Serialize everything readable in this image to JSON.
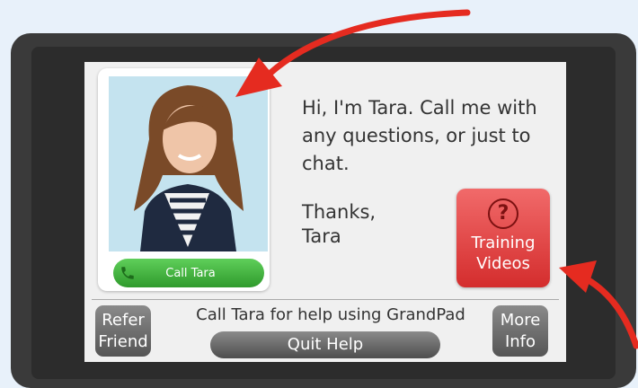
{
  "contact": {
    "name": "Tara",
    "call_label": "Call Tara"
  },
  "message": {
    "line1": "Hi, I'm Tara. Call me with any questions, or just to chat.",
    "thanks": "Thanks,",
    "signature": "Tara"
  },
  "training": {
    "label_line1": "Training",
    "label_line2": "Videos",
    "icon": "question-circle-icon"
  },
  "footer": {
    "refer_line1": "Refer",
    "refer_line2": "Friend",
    "help_text": "Call Tara for help using GrandPad",
    "quit_label": "Quit Help",
    "more_line1": "More",
    "more_line2": "Info"
  },
  "colors": {
    "call_green": "#3fb43a",
    "training_red": "#e04444",
    "annotation_arrow": "#e52b20"
  }
}
